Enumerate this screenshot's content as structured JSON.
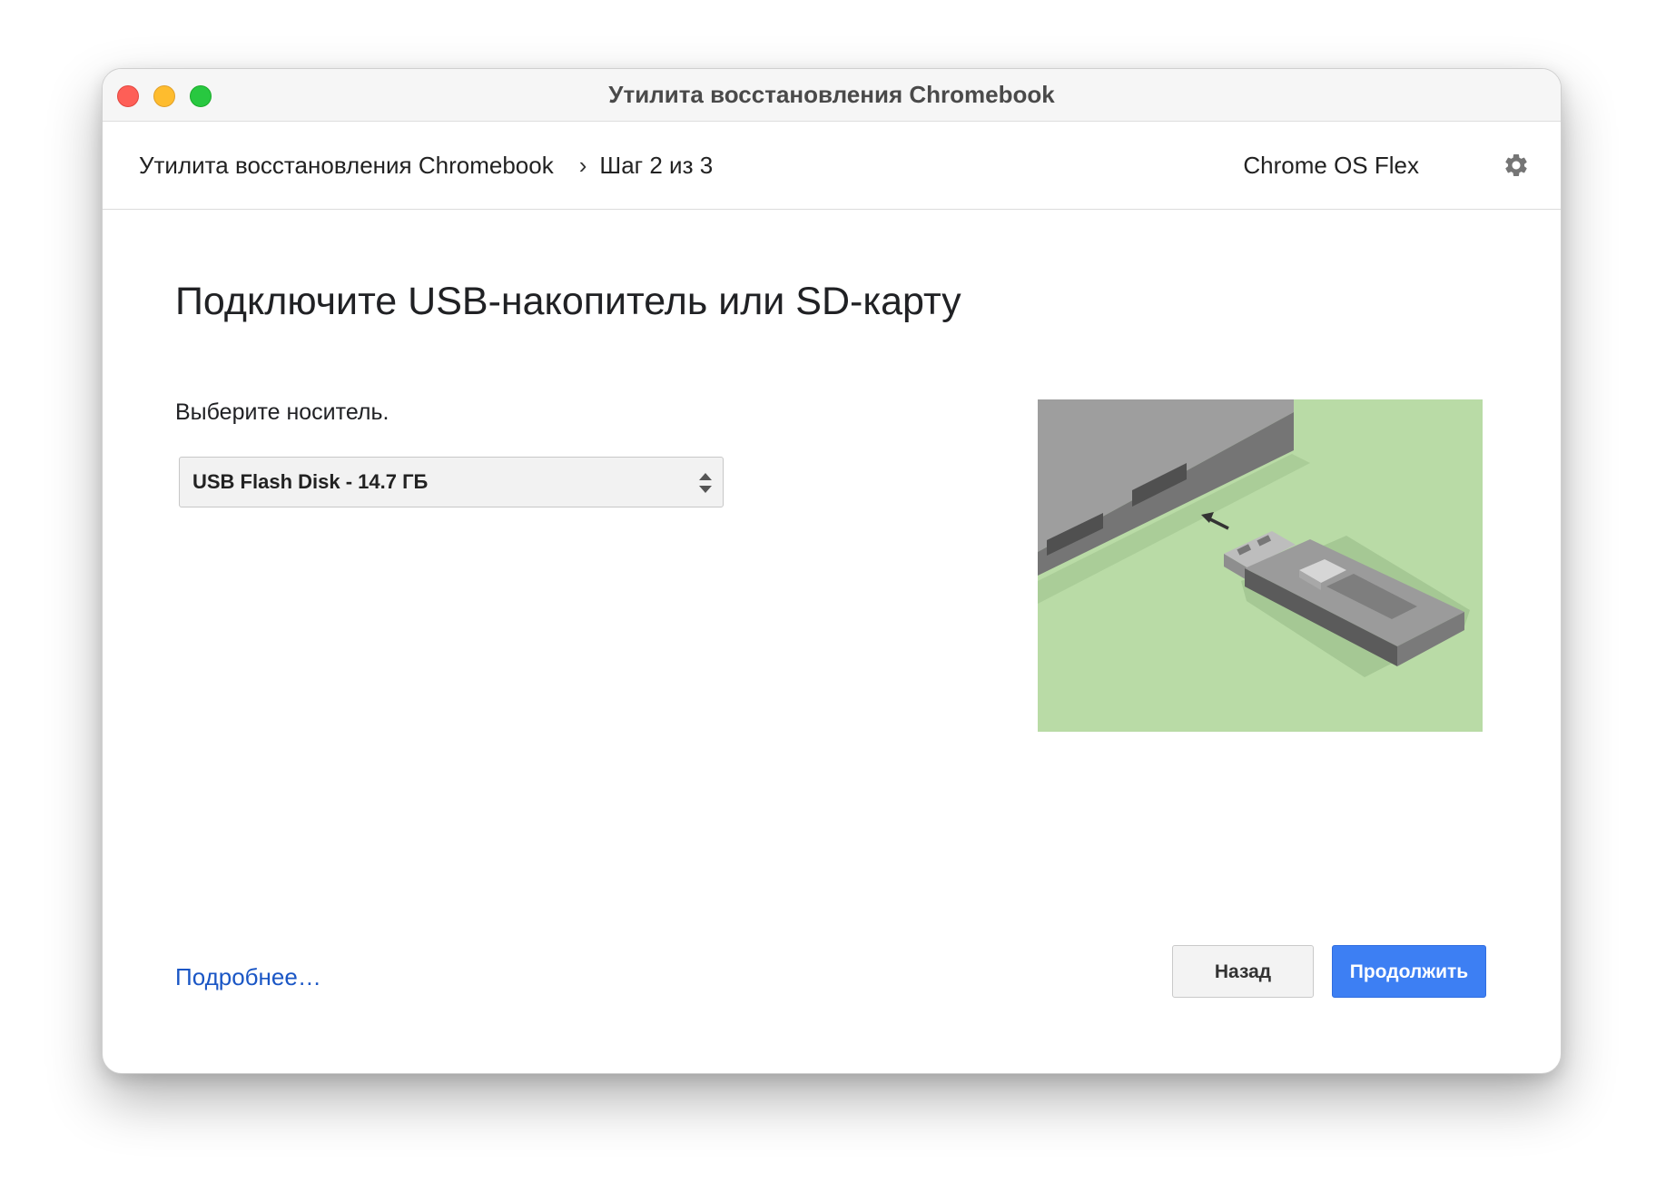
{
  "window": {
    "title": "Утилита восстановления Chromebook"
  },
  "header": {
    "breadcrumb_root": "Утилита восстановления Chromebook",
    "breadcrumb_separator": "›",
    "breadcrumb_step": "Шаг 2 из 3",
    "product_name": "Chrome OS Flex",
    "settings_icon": "gear-icon"
  },
  "main": {
    "heading": "Подключите USB-накопитель или SD-карту",
    "select_label": "Выберите носитель.",
    "media_select_value": "USB Flash Disk - 14.7 ГБ",
    "illustration": "usb-insert-illustration"
  },
  "footer": {
    "more_link": "Подробнее…",
    "back_label": "Назад",
    "continue_label": "Продолжить"
  },
  "colors": {
    "accent": "#3d7ff3",
    "link": "#1a56c5",
    "illustration_bg": "#b9dba6"
  }
}
